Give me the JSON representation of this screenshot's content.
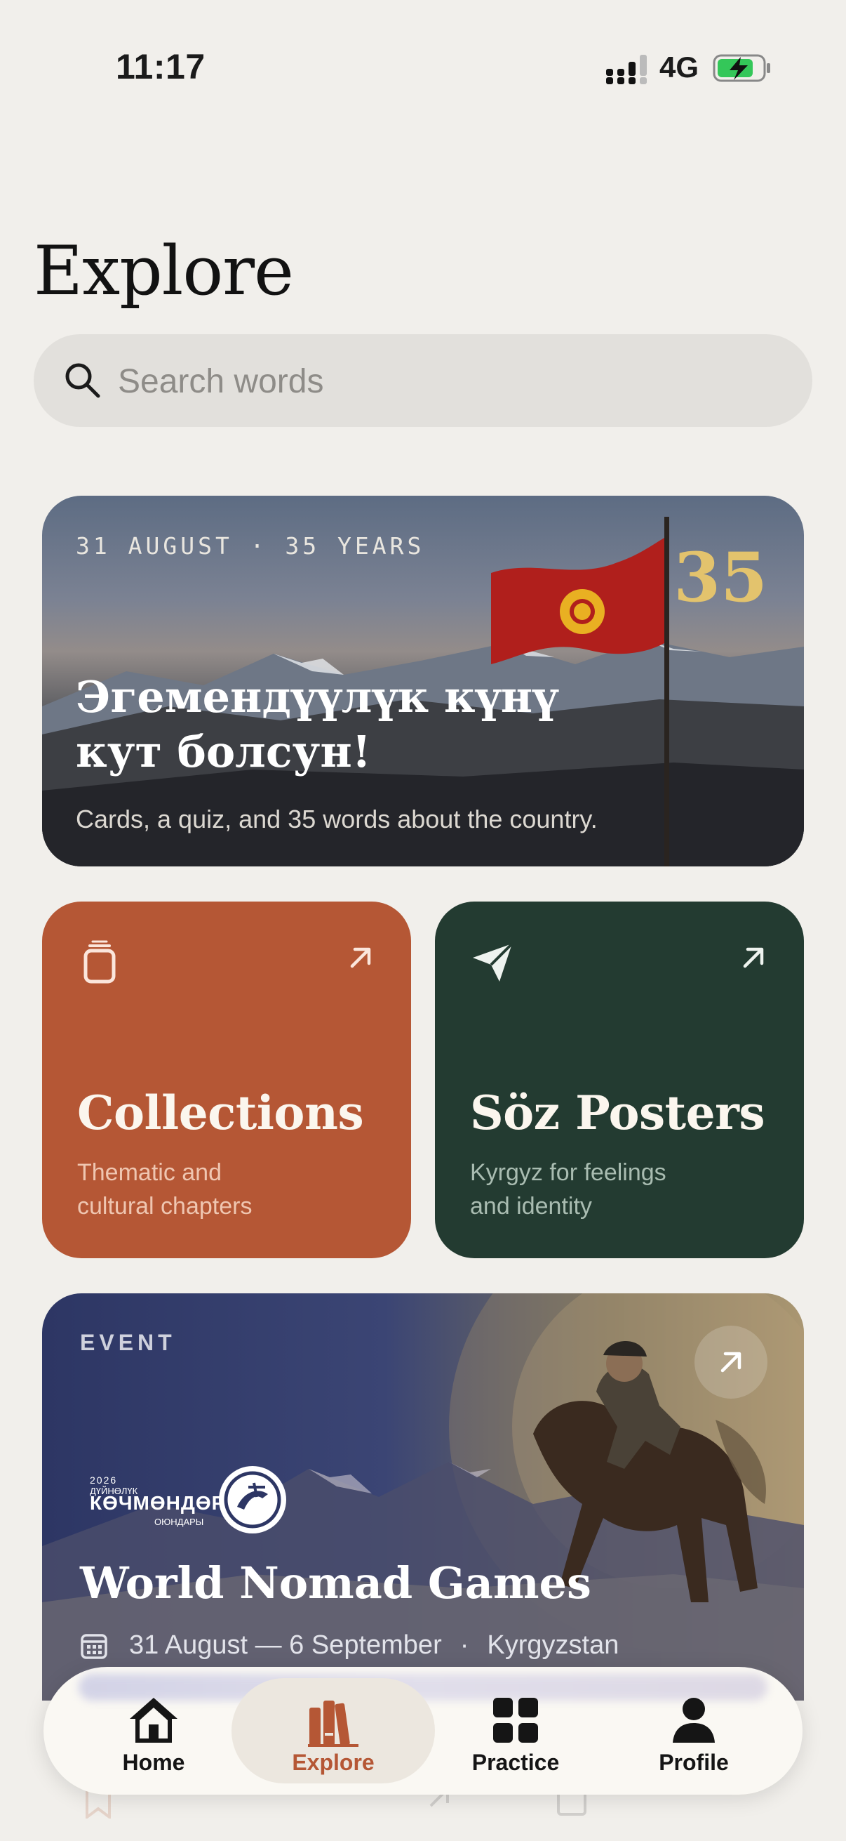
{
  "status": {
    "time": "11:17",
    "network": "4G"
  },
  "page": {
    "title": "Explore"
  },
  "search": {
    "placeholder": "Search words",
    "value": ""
  },
  "hero": {
    "meta": "31 AUGUST · 35 YEARS",
    "badge": "35",
    "headline_line1": "Эгемендүүлүк күнү",
    "headline_line2": "кут болсун!",
    "subtitle": "Cards, a quiz, and 35 words about the country."
  },
  "tiles": [
    {
      "title": "Collections",
      "desc_line1": "Thematic and",
      "desc_line2": "cultural chapters",
      "icon": "cards-icon",
      "color": "#b55735"
    },
    {
      "title": "Söz Posters",
      "desc_line1": "Kyrgyz for feelings",
      "desc_line2": "and identity",
      "icon": "paper-plane-icon",
      "color": "#233b31"
    }
  ],
  "event": {
    "label": "EVENT",
    "logo_year": "2026",
    "logo_small": "ДҮЙНӨЛҮК",
    "logo_main": "КӨЧМӨНДӨР",
    "logo_sub": "ОЮНДАРЫ",
    "title": "World Nomad Games",
    "dates": "31 August — 6 September",
    "location": "Kyrgyzstan"
  },
  "nav": {
    "items": [
      {
        "label": "Home",
        "icon": "home-icon"
      },
      {
        "label": "Explore",
        "icon": "books-icon",
        "active": true
      },
      {
        "label": "Practice",
        "icon": "grid-icon"
      },
      {
        "label": "Profile",
        "icon": "person-icon"
      }
    ],
    "active_color": "#b55735"
  }
}
